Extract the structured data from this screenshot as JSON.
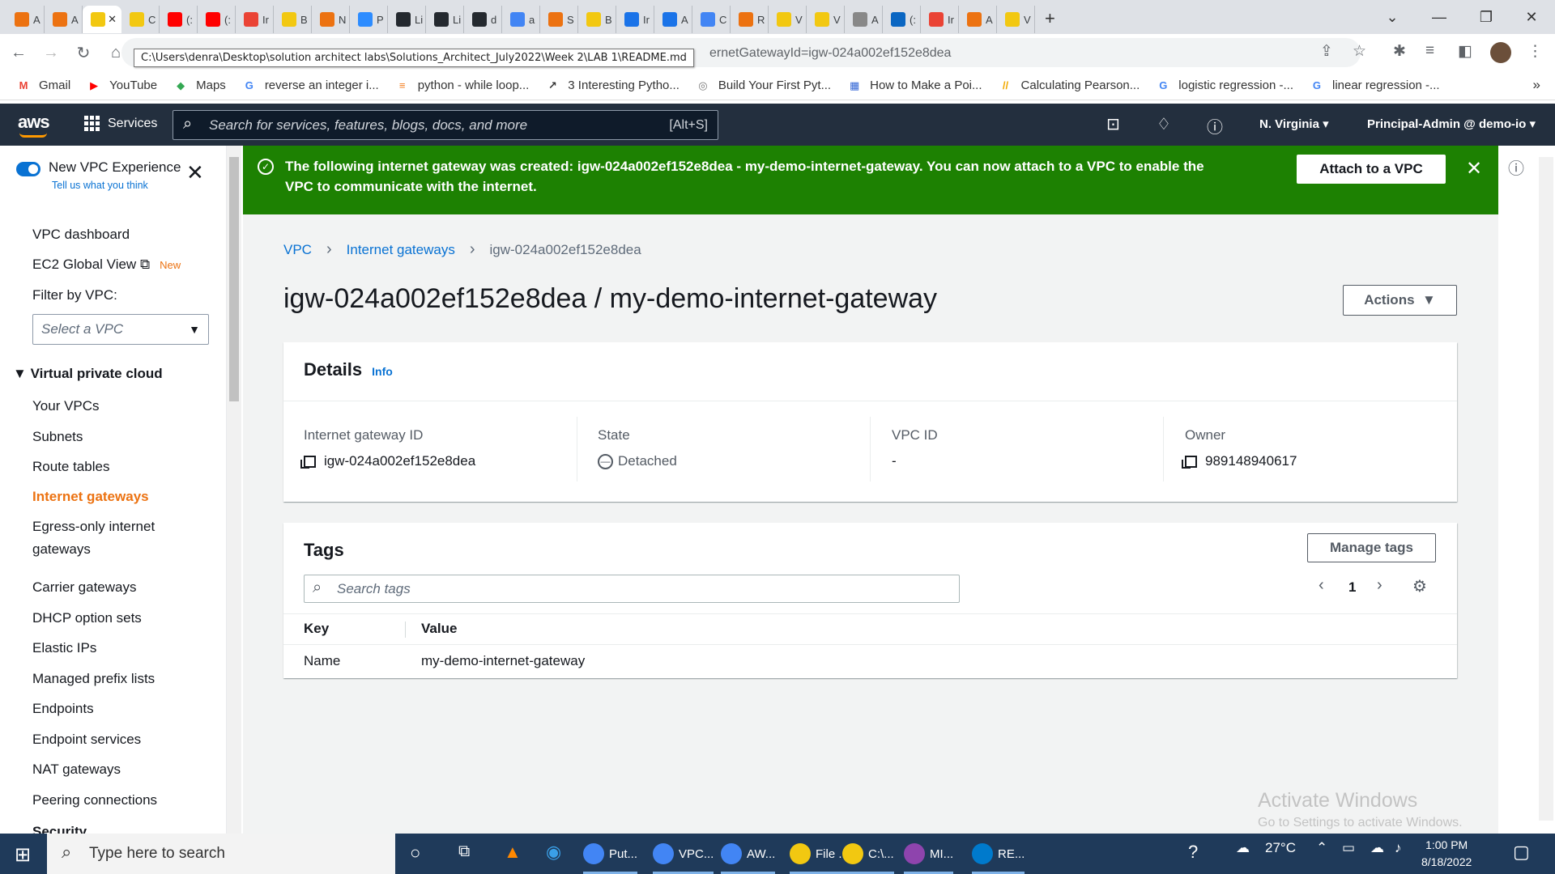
{
  "browser": {
    "tabs": [
      {
        "letter": "A",
        "color": "#ec7211"
      },
      {
        "letter": "A",
        "color": "#ec7211"
      },
      {
        "letter": "",
        "color": "#f2c811",
        "active": true
      },
      {
        "letter": "C",
        "color": "#f2c811"
      },
      {
        "letter": "(:",
        "color": "#ff0000"
      },
      {
        "letter": "(:",
        "color": "#ff0000"
      },
      {
        "letter": "Ir",
        "color": "#ea4335"
      },
      {
        "letter": "B",
        "color": "#f2c811"
      },
      {
        "letter": "N",
        "color": "#ec7211"
      },
      {
        "letter": "P",
        "color": "#2d8cff"
      },
      {
        "letter": "Li",
        "color": "#24292f"
      },
      {
        "letter": "Li",
        "color": "#24292f"
      },
      {
        "letter": "d",
        "color": "#24292f"
      },
      {
        "letter": "a",
        "color": "#4285f4"
      },
      {
        "letter": "S",
        "color": "#ec7211"
      },
      {
        "letter": "B",
        "color": "#f2c811"
      },
      {
        "letter": "Ir",
        "color": "#1a73e8"
      },
      {
        "letter": "A",
        "color": "#1a73e8"
      },
      {
        "letter": "C",
        "color": "#4285f4"
      },
      {
        "letter": "R",
        "color": "#ec7211"
      },
      {
        "letter": "V",
        "color": "#f2c811"
      },
      {
        "letter": "V",
        "color": "#f2c811"
      },
      {
        "letter": "A",
        "color": "#888888"
      },
      {
        "letter": "(:",
        "color": "#0a66c2"
      },
      {
        "letter": "Ir",
        "color": "#ea4335"
      },
      {
        "letter": "A",
        "color": "#ec7211"
      },
      {
        "letter": "V",
        "color": "#f2c811"
      }
    ],
    "new_tab": "+",
    "url_tail": "ernetGatewayId=igw-024a002ef152e8dea",
    "tooltip": "C:\\Users\\denra\\Desktop\\solution architect labs\\Solutions_Architect_July2022\\Week 2\\LAB 1\\README.md",
    "bookmarks": [
      {
        "label": "Gmail",
        "icon": "gmail-icon",
        "color": "#ea4335",
        "glyph": "M"
      },
      {
        "label": "YouTube",
        "icon": "youtube-icon",
        "color": "#ff0000",
        "glyph": "▶"
      },
      {
        "label": "Maps",
        "icon": "maps-icon",
        "color": "#34a853",
        "glyph": "◆"
      },
      {
        "label": "reverse an integer i...",
        "icon": "google-icon",
        "color": "#4285f4",
        "glyph": "G"
      },
      {
        "label": "python - while loop...",
        "icon": "stackoverflow-icon",
        "color": "#f48024",
        "glyph": "≡"
      },
      {
        "label": "3 Interesting Pytho...",
        "icon": "chart-icon",
        "color": "#333333",
        "glyph": "↗"
      },
      {
        "label": "Build Your First Pyt...",
        "icon": "python-icon",
        "color": "#777777",
        "glyph": "◎"
      },
      {
        "label": "How to Make a Poi...",
        "icon": "site-icon",
        "color": "#3367d6",
        "glyph": "▦"
      },
      {
        "label": "Calculating Pearson...",
        "icon": "site-icon",
        "color": "#f2a900",
        "glyph": "//"
      },
      {
        "label": "logistic regression -...",
        "icon": "google-icon",
        "color": "#4285f4",
        "glyph": "G"
      },
      {
        "label": "linear regression -...",
        "icon": "google-icon",
        "color": "#4285f4",
        "glyph": "G"
      }
    ],
    "more": "»"
  },
  "aws": {
    "logo": "aws",
    "services": "Services",
    "search_placeholder": "Search for services, features, blogs, docs, and more",
    "search_shortcut": "[Alt+S]",
    "region": "N. Virginia",
    "account": "Principal-Admin @ demo-io"
  },
  "sidebar": {
    "toggle_label": "New VPC Experience",
    "toggle_sub": "Tell us what you think",
    "items_top": [
      "VPC dashboard",
      "EC2 Global View"
    ],
    "new_badge": "New",
    "filter_label": "Filter by VPC:",
    "filter_placeholder": "Select a VPC",
    "section": "Virtual private cloud",
    "items": [
      "Your VPCs",
      "Subnets",
      "Route tables",
      "Internet gateways",
      "Egress-only internet gateways",
      "Carrier gateways",
      "DHCP option sets",
      "Elastic IPs",
      "Managed prefix lists",
      "Endpoints",
      "Endpoint services",
      "NAT gateways",
      "Peering connections"
    ],
    "active": "Internet gateways",
    "cut_off": "Security"
  },
  "flash": {
    "message": "The following internet gateway was created: igw-024a002ef152e8dea - my-demo-internet-gateway. You can now attach to a VPC to enable the VPC to communicate with the internet.",
    "button": "Attach to a VPC"
  },
  "breadcrumb": [
    "VPC",
    "Internet gateways",
    "igw-024a002ef152e8dea"
  ],
  "page_title": "igw-024a002ef152e8dea / my-demo-internet-gateway",
  "actions_label": "Actions",
  "details": {
    "heading": "Details",
    "info": "Info",
    "fields": [
      {
        "label": "Internet gateway ID",
        "value": "igw-024a002ef152e8dea",
        "copy": true
      },
      {
        "label": "State",
        "value": "Detached",
        "status": true
      },
      {
        "label": "VPC ID",
        "value": "-"
      },
      {
        "label": "Owner",
        "value": "989148940617",
        "copy": true
      }
    ]
  },
  "tags": {
    "heading": "Tags",
    "manage": "Manage tags",
    "search_placeholder": "Search tags",
    "page": "1",
    "columns": [
      "Key",
      "Value"
    ],
    "rows": [
      [
        "Name",
        "my-demo-internet-gateway"
      ]
    ]
  },
  "watermark": {
    "line1": "Activate Windows",
    "line2": "Go to Settings to activate Windows."
  },
  "taskbar": {
    "search_placeholder": "Type here to search",
    "apps": [
      {
        "label": "Put...",
        "color": "#4285f4"
      },
      {
        "label": "VPC...",
        "color": "#4285f4"
      },
      {
        "label": "AW...",
        "color": "#4285f4"
      },
      {
        "label": "File ...",
        "color": "#f2c811"
      },
      {
        "label": "C:\\...",
        "color": "#f2c811"
      },
      {
        "label": "MI...",
        "color": "#8e44ad"
      },
      {
        "label": "RE...",
        "color": "#007acc"
      }
    ],
    "temperature": "27°C",
    "time": "1:00 PM",
    "date": "8/18/2022"
  }
}
